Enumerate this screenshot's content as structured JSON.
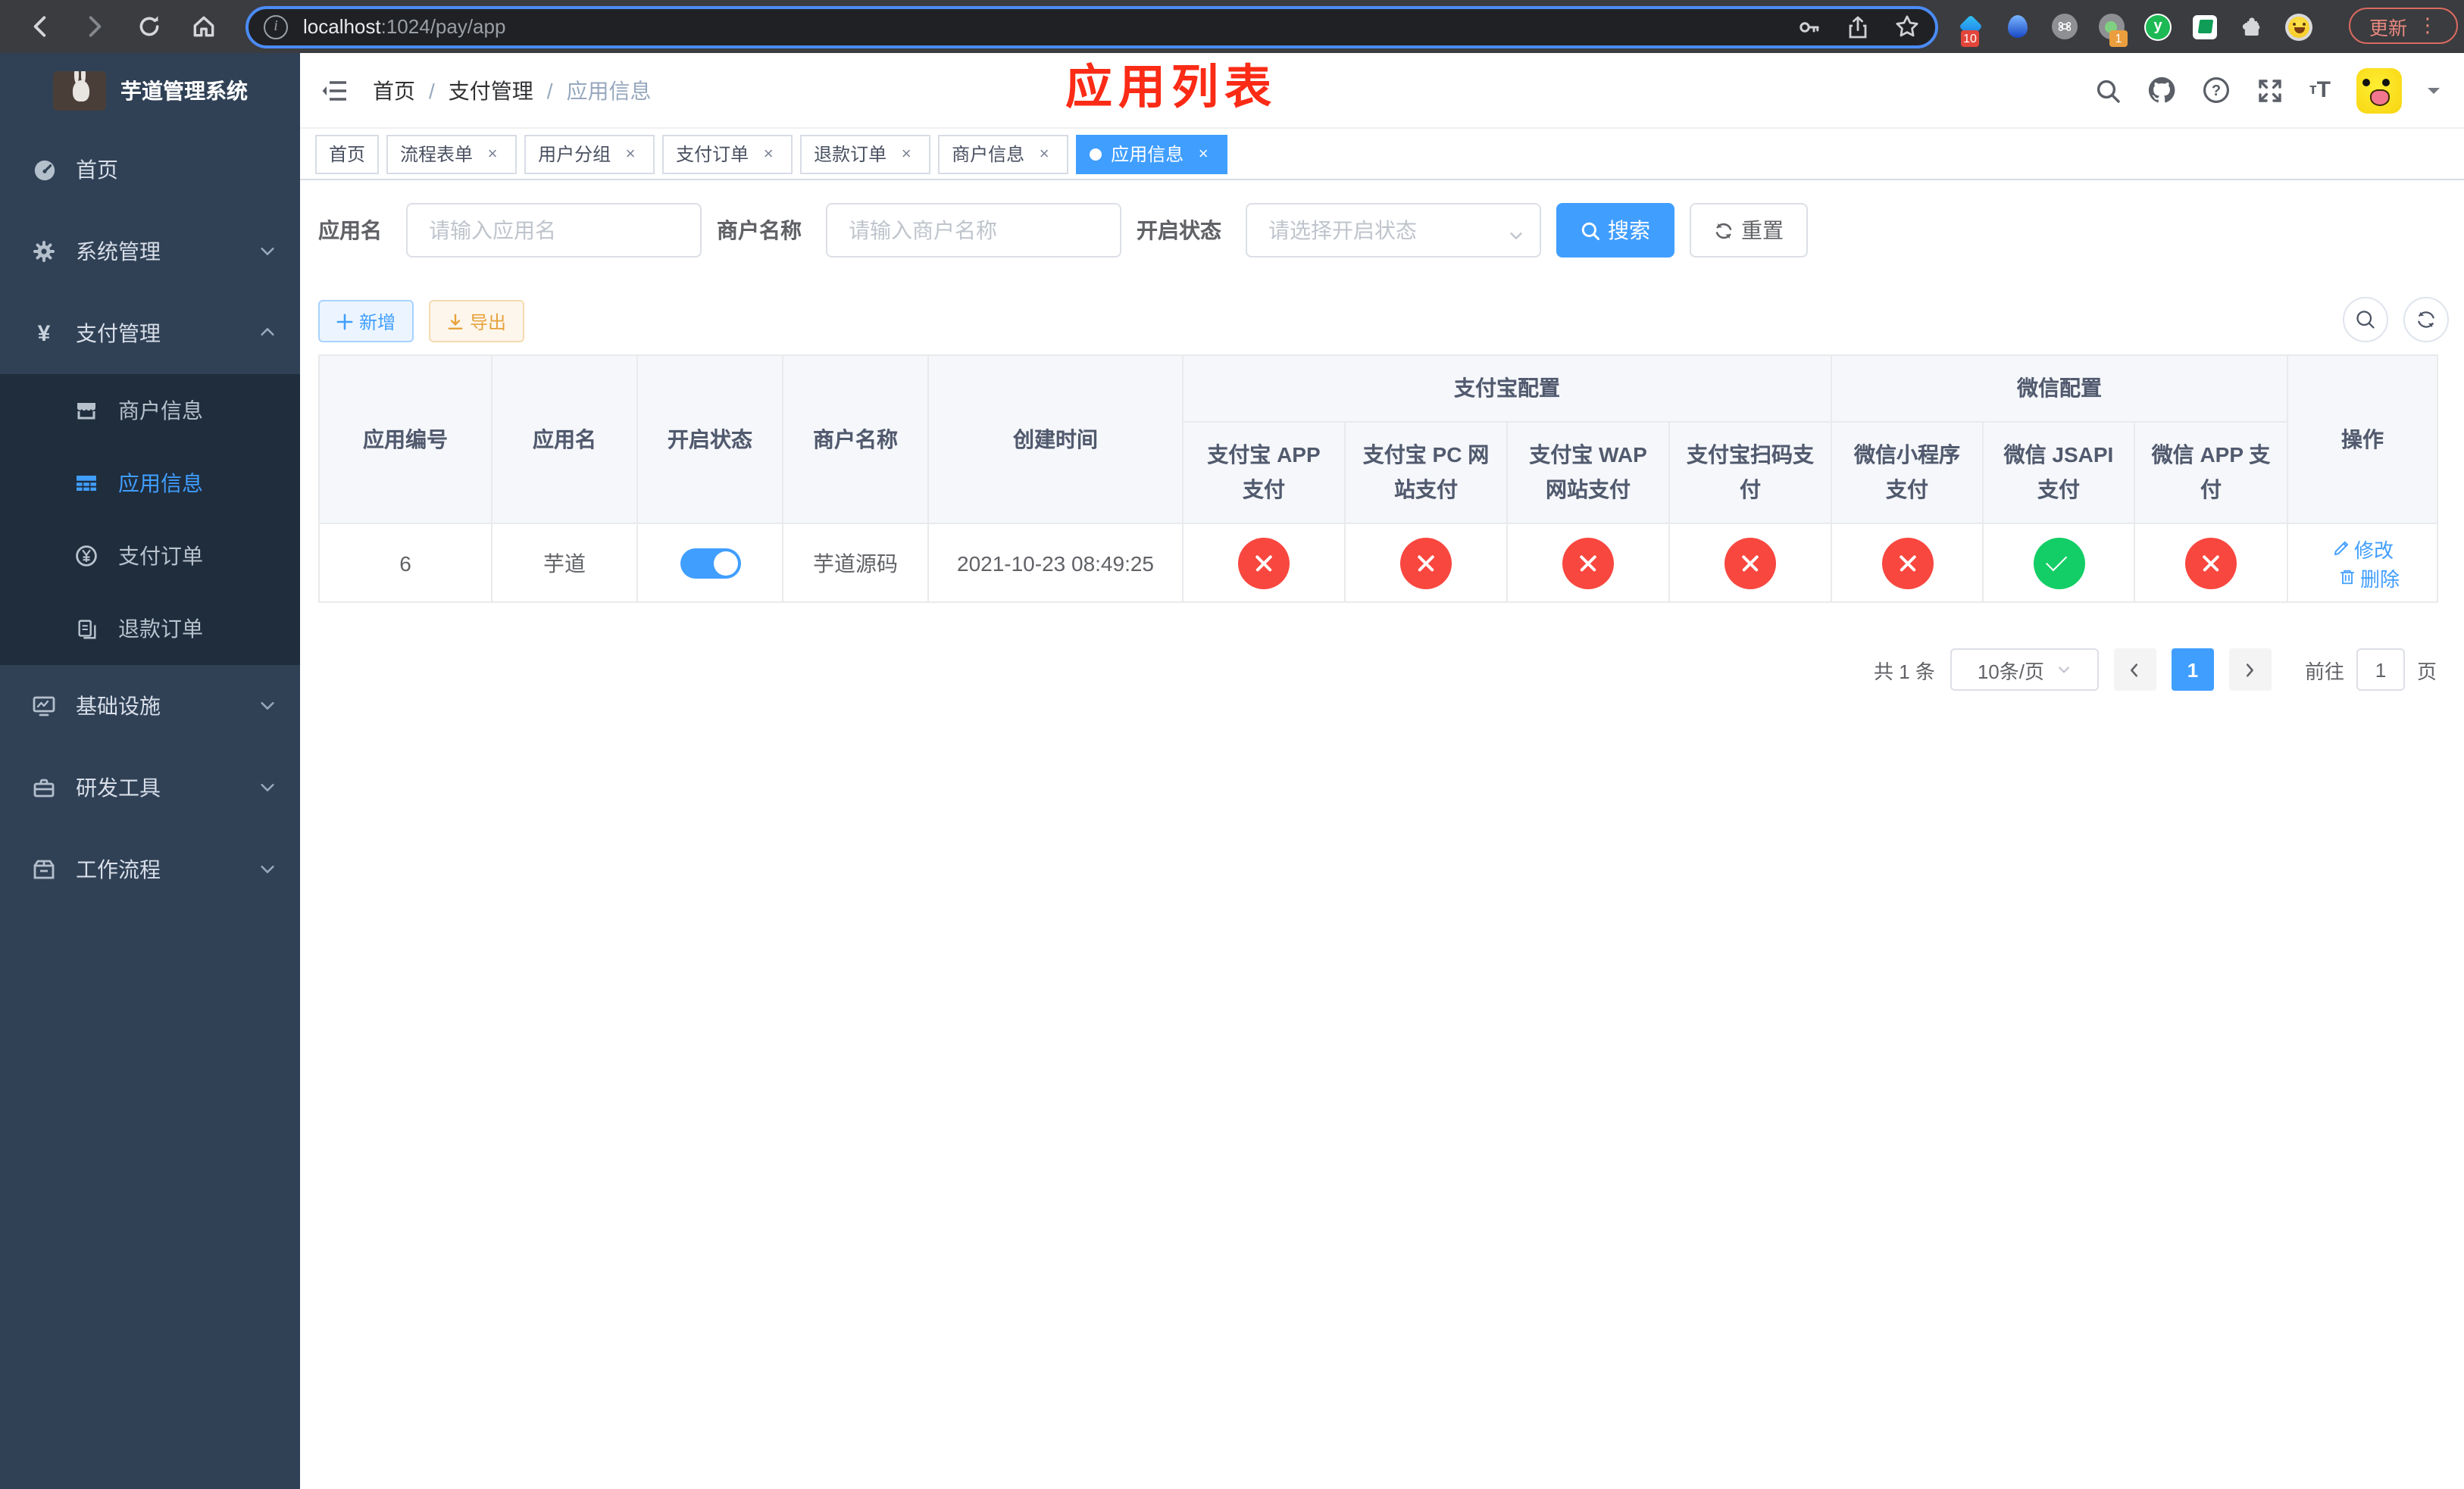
{
  "colors": {
    "accent": "#409eff",
    "danger": "#f8473f",
    "success": "#13ce66",
    "warning": "#e6a23c",
    "annotation": "#fb2b16"
  },
  "browser": {
    "url_host": "localhost",
    "url_rest": ":1024/pay/app",
    "update_label": "更新",
    "ext_badge_diamond": "10",
    "ext_badge_record": "1",
    "ext_y_letter": "y"
  },
  "icons": {
    "close": "×",
    "dots": "⋮",
    "slash": "/",
    "yen": "¥",
    "question": "?",
    "font_small": "т",
    "font_large": "T",
    "info": "i"
  },
  "sidebar": {
    "logo_title": "芋道管理系统",
    "items": [
      {
        "label": "首页"
      },
      {
        "label": "系统管理"
      },
      {
        "label": "支付管理"
      },
      {
        "label": "基础设施"
      },
      {
        "label": "研发工具"
      },
      {
        "label": "工作流程"
      }
    ],
    "submenu": [
      {
        "label": "商户信息"
      },
      {
        "label": "应用信息"
      },
      {
        "label": "支付订单"
      },
      {
        "label": "退款订单"
      }
    ]
  },
  "navbar": {
    "breadcrumb": [
      "首页",
      "支付管理",
      "应用信息"
    ],
    "annotation": "应用列表"
  },
  "tabs": [
    {
      "label": "首页"
    },
    {
      "label": "流程表单"
    },
    {
      "label": "用户分组"
    },
    {
      "label": "支付订单"
    },
    {
      "label": "退款订单"
    },
    {
      "label": "商户信息"
    },
    {
      "label": "应用信息"
    }
  ],
  "filters": {
    "app_name_label": "应用名",
    "app_name_placeholder": "请输入应用名",
    "merchant_label": "商户名称",
    "merchant_placeholder": "请输入商户名称",
    "status_label": "开启状态",
    "status_placeholder": "请选择开启状态",
    "search_label": "搜索",
    "reset_label": "重置"
  },
  "toolbar": {
    "add_label": "新增",
    "export_label": "导出"
  },
  "table": {
    "col_id": "应用编号",
    "col_name": "应用名",
    "col_status": "开启状态",
    "col_merchant": "商户名称",
    "col_created": "创建时间",
    "group_alipay": "支付宝配置",
    "group_wechat": "微信配置",
    "col_actions": "操作",
    "alipay_cols": [
      "支付宝 APP 支付",
      "支付宝 PC 网站支付",
      "支付宝 WAP 网站支付",
      "支付宝扫码支付"
    ],
    "wechat_cols": [
      "微信小程序支付",
      "微信 JSAPI 支付",
      "微信 APP 支付"
    ],
    "rows": [
      {
        "id": "6",
        "name": "芋道",
        "enabled": true,
        "merchant": "芋道源码",
        "created": "2021-10-23 08:49:25",
        "statuses": [
          false,
          false,
          false,
          false,
          false,
          true,
          false
        ],
        "edit_label": "修改",
        "delete_label": "删除"
      }
    ]
  },
  "pagination": {
    "total": "共 1 条",
    "page_size": "10条/页",
    "current": "1",
    "goto_label": "前往",
    "goto_value": "1",
    "page_suffix": "页"
  }
}
